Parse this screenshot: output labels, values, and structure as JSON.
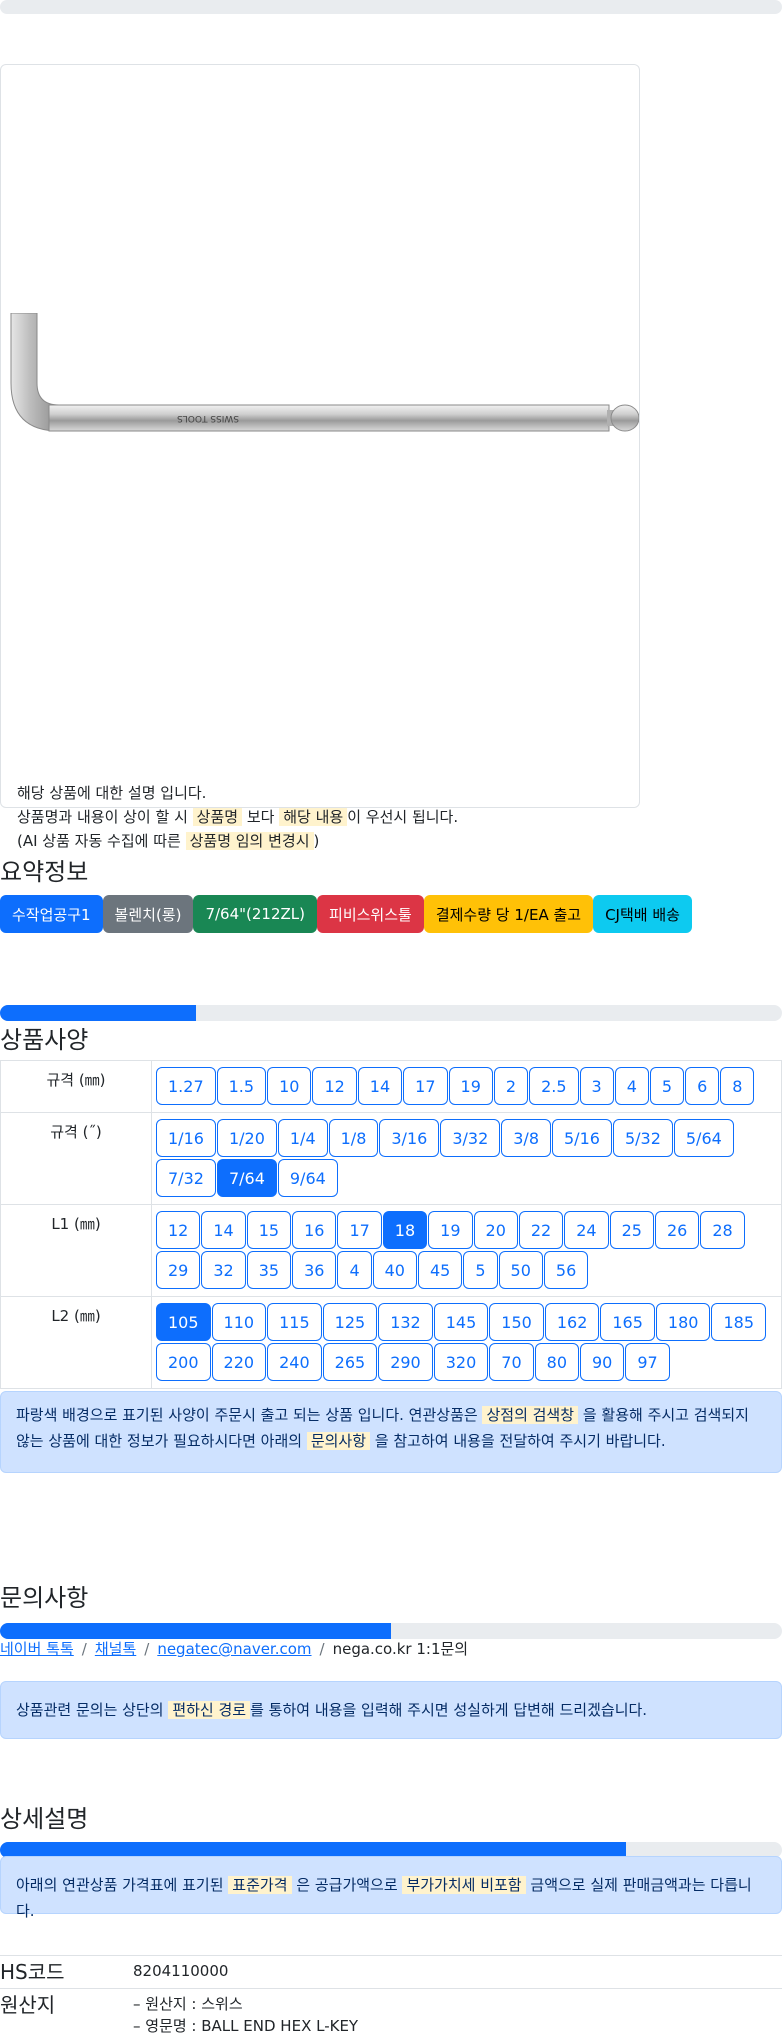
{
  "product": {
    "desc_line1": "해당 상품에 대한 설명 입니다.",
    "desc_line2_a": "상품명과 내용이 상이 할 시",
    "desc_line2_hl1": "상품명",
    "desc_line2_b": "보다",
    "desc_line2_hl2": "해당 내용",
    "desc_line2_c": "이 우선시 됩니다.",
    "desc_line3_a": "(AI 상품 자동 수집에 따른",
    "desc_line3_hl": "상품명 임의 변경시",
    "desc_line3_b": ")",
    "image_text": "SWISS TOOLS"
  },
  "summary": {
    "title": "요약정보",
    "badges": [
      "수작업공구1",
      "볼렌치(롱)",
      "7/64\"(212ZL)",
      "피비스위스툴",
      "결제수량 당 1/EA 출고",
      "CJ택배 배송"
    ]
  },
  "specs": {
    "title": "상품사양",
    "progress": 0.25,
    "rows": [
      {
        "label": "규격 (㎜)",
        "options": [
          "1.27",
          "1.5",
          "10",
          "12",
          "14",
          "17",
          "19",
          "2",
          "2.5",
          "3",
          "4",
          "5",
          "6",
          "8"
        ],
        "selected": ""
      },
      {
        "label": "규격 (˝)",
        "options": [
          "1/16",
          "1/20",
          "1/4",
          "1/8",
          "3/16",
          "3/32",
          "3/8",
          "5/16",
          "5/32",
          "5/64",
          "7/32",
          "7/64",
          "9/64"
        ],
        "selected": "7/64"
      },
      {
        "label": "L1 (㎜)",
        "options": [
          "12",
          "14",
          "15",
          "16",
          "17",
          "18",
          "19",
          "20",
          "22",
          "24",
          "25",
          "26",
          "28",
          "29",
          "32",
          "35",
          "36",
          "4",
          "40",
          "45",
          "5",
          "50",
          "56"
        ],
        "selected": "18"
      },
      {
        "label": "L2 (㎜)",
        "options": [
          "105",
          "110",
          "115",
          "125",
          "132",
          "145",
          "150",
          "162",
          "165",
          "180",
          "185",
          "200",
          "220",
          "240",
          "265",
          "290",
          "320",
          "70",
          "80",
          "90",
          "97"
        ],
        "selected": "105"
      }
    ],
    "notice_a": "파랑색 배경으로 표기된 사양이 주문시 출고 되는 상품 입니다. 연관상품은",
    "notice_hl1": "상점의 검색창",
    "notice_b": "을 활용해 주시고 검색되지 않는 상품에 대한 정보가 필요하시다면 아래의",
    "notice_hl2": "문의사항",
    "notice_c": "을 참고하여 내용을 전달하여 주시기 바랍니다."
  },
  "inquiry": {
    "title": "문의사항",
    "progress": 0.5,
    "link1": "네이버 톡톡",
    "link2": "채널톡",
    "link3": "negatec@naver.com",
    "plain": "nega.co.kr 1:1문의",
    "sep": "/",
    "notice_a": "상품관련 문의는 상단의",
    "notice_hl": "편하신 경로",
    "notice_b": "를 통하여 내용을 입력해 주시면 성실하게 답변해 드리겠습니다."
  },
  "detail": {
    "title": "상세설명",
    "progress": 0.8,
    "notice_a": "아래의 연관상품 가격표에 표기된",
    "notice_hl1": "표준가격",
    "notice_b": "은 공급가액으로",
    "notice_hl2": "부가가치세 비포함",
    "notice_c": "금액으로 실제 판매금액과는 다릅니다.",
    "hs_label": "HS코드",
    "hs_value": "8204110000",
    "origin_label": "원산지",
    "origin_line1": "– 원산지 : 스위스",
    "origin_line2": "– 영문명 : BALL END HEX L-KEY"
  },
  "colors": {
    "primary": "#0d6efd",
    "highlight": "#fff3cd",
    "alert_bg": "#cfe2ff"
  }
}
